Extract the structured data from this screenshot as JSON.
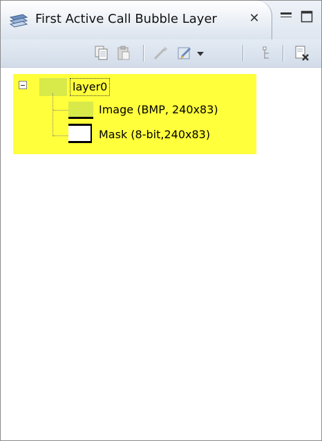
{
  "view": {
    "title": "First Active Call Bubble Layer",
    "close_glyph": "✕"
  },
  "toolbar": {
    "buttons": [
      "copy-icon",
      "paste-icon",
      "cut-icon",
      "edit-icon",
      "dropdown-arrow-icon",
      "hierarchy-icon",
      "delete-layer-icon"
    ]
  },
  "tree": {
    "root": {
      "label": "layer0",
      "expanded": true
    },
    "children": [
      {
        "label": "Image (BMP, 240x83)"
      },
      {
        "label": "Mask (8-bit,240x83)"
      }
    ]
  },
  "colors": {
    "highlight": "#ffff3c",
    "layer_icon": "#d8e94a",
    "toolbar": "#d8e1ec"
  }
}
